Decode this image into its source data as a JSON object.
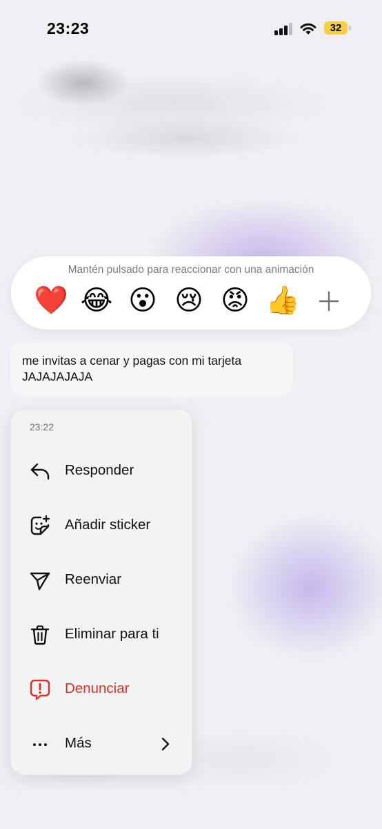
{
  "status_bar": {
    "time": "23:23",
    "battery_level": "32",
    "signal_bars_active": 3,
    "signal_bars_total": 4,
    "icons": [
      "signal-icon",
      "wifi-icon",
      "battery-icon"
    ]
  },
  "reaction_bar": {
    "hint": "Mantén pulsado para reaccionar con una animación",
    "emojis": [
      "❤️",
      "😂",
      "😮",
      "😢",
      "😡",
      "👍"
    ],
    "more_icon": "plus-icon"
  },
  "message": {
    "text": "me invitas a cenar y pagas con mi tarjeta JAJAJAJAJA"
  },
  "context_menu": {
    "timestamp": "23:22",
    "items": [
      {
        "label": "Responder",
        "icon": "reply-icon"
      },
      {
        "label": "Añadir sticker",
        "icon": "sticker-icon"
      },
      {
        "label": "Reenviar",
        "icon": "forward-icon"
      },
      {
        "label": "Eliminar para ti",
        "icon": "trash-icon"
      },
      {
        "label": "Denunciar",
        "icon": "report-icon",
        "color": "#d93025"
      },
      {
        "label": "Más",
        "icon": "more-dots-icon",
        "trailing_icon": "chevron-right-icon"
      }
    ]
  },
  "colors": {
    "danger": "#d93025",
    "battery": "#f4cf41",
    "background": "#f0eff3"
  }
}
